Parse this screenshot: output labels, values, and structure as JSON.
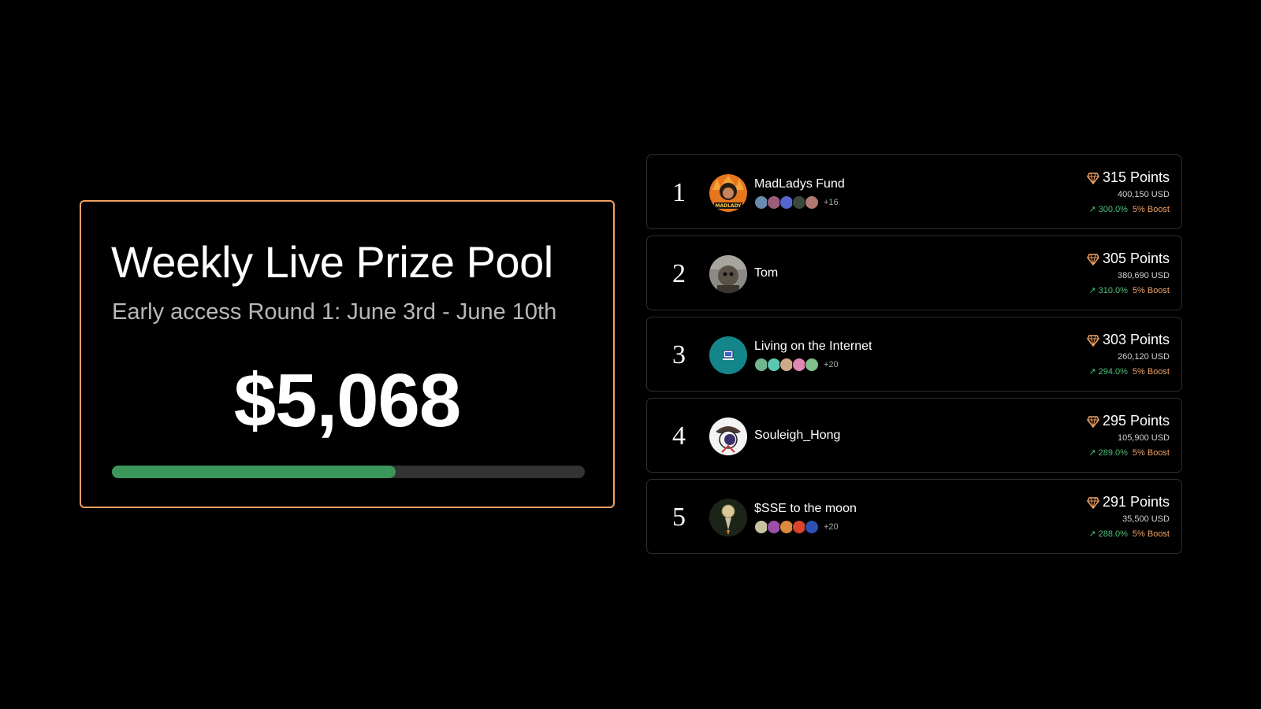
{
  "pool": {
    "title": "Weekly Live Prize Pool",
    "subtitle": "Early access Round 1: June 3rd - June 10th",
    "amount": "$5,068",
    "progress": 0.6
  },
  "leaderboard": [
    {
      "rank": "1",
      "name": "MadLadys Fund",
      "points": "315 Points",
      "usd": "400,150 USD",
      "change": "↗ 300.0%",
      "boost": "5% Boost",
      "members_more": "+16",
      "avatar_icon": "madladys-avatar",
      "avatar_color": "#e7761f"
    },
    {
      "rank": "2",
      "name": "Tom",
      "points": "305 Points",
      "usd": "380,690 USD",
      "change": "↗ 310.0%",
      "boost": "5% Boost",
      "members_more": "",
      "avatar_icon": "tom-avatar",
      "avatar_color": "#7b7a78"
    },
    {
      "rank": "3",
      "name": "Living on the Internet",
      "points": "303 Points",
      "usd": "260,120 USD",
      "change": "↗ 294.0%",
      "boost": "5% Boost",
      "members_more": "+20",
      "avatar_icon": "computer-avatar",
      "avatar_color": "#14868a"
    },
    {
      "rank": "4",
      "name": "Souleigh_Hong",
      "points": "295 Points",
      "usd": "105,900 USD",
      "change": "↗ 289.0%",
      "boost": "5% Boost",
      "members_more": "",
      "avatar_icon": "souleigh-avatar",
      "avatar_color": "#f3f3f3"
    },
    {
      "rank": "5",
      "name": "$SSE to the moon",
      "points": "291 Points",
      "usd": "35,500 USD",
      "change": "↗ 288.0%",
      "boost": "5% Boost",
      "members_more": "+20",
      "avatar_icon": "sse-rocket-avatar",
      "avatar_color": "#1c2418"
    }
  ],
  "colors": {
    "accent": "#f0a062",
    "progress": "#3a9659",
    "positive": "#4fbf7a"
  }
}
